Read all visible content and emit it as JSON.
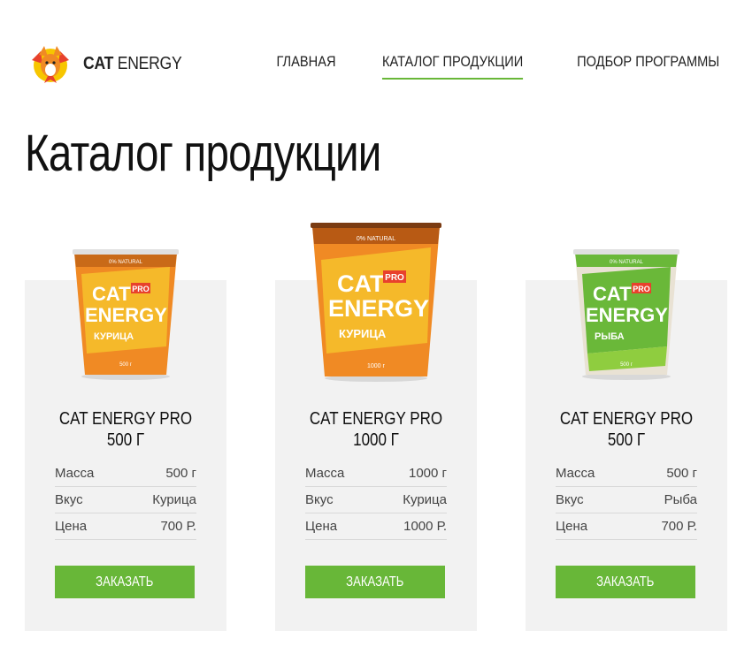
{
  "header": {
    "logo_bold": "CAT",
    "logo_light": "ENERGY",
    "nav": [
      {
        "label": "ГЛАВНАЯ",
        "active": false
      },
      {
        "label": "КАТАЛОГ ПРОДУКЦИИ",
        "active": true
      },
      {
        "label": "ПОДБОР ПРОГРАММЫ",
        "active": false
      }
    ]
  },
  "page_title": "Каталог продукции",
  "products": [
    {
      "title_line1": "CAT ENERGY PRO",
      "title_line2": "500 Г",
      "cup": {
        "brand1": "CAT",
        "brand2": "ENERGY",
        "pro": "PRO",
        "flavor": "КУРИЦА",
        "weight": "500 г",
        "top_text": "0% NATURAL",
        "color": "#f08a24",
        "band": "#f5b92a"
      },
      "specs": [
        {
          "label": "Масса",
          "value": "500 г"
        },
        {
          "label": "Вкус",
          "value": "Курица"
        },
        {
          "label": "Цена",
          "value": "700 Р."
        }
      ],
      "button": "ЗАКАЗАТЬ"
    },
    {
      "title_line1": "CAT ENERGY PRO",
      "title_line2": "1000 Г",
      "cup": {
        "brand1": "CAT",
        "brand2": "ENERGY",
        "pro": "PRO",
        "flavor": "КУРИЦА",
        "weight": "1000 г",
        "top_text": "0% NATURAL",
        "color": "#f08a24",
        "band": "#f5b92a"
      },
      "specs": [
        {
          "label": "Масса",
          "value": "1000 г"
        },
        {
          "label": "Вкус",
          "value": "Курица"
        },
        {
          "label": "Цена",
          "value": "1000 Р."
        }
      ],
      "button": "ЗАКАЗАТЬ"
    },
    {
      "title_line1": "CAT ENERGY PRO",
      "title_line2": "500 Г",
      "cup": {
        "brand1": "CAT",
        "brand2": "ENERGY",
        "pro": "PRO",
        "flavor": "РЫБА",
        "weight": "500 г",
        "top_text": "0% NATURAL",
        "color": "#6ab839",
        "band": "#8fcd3f"
      },
      "specs": [
        {
          "label": "Масса",
          "value": "500 г"
        },
        {
          "label": "Вкус",
          "value": "Рыба"
        },
        {
          "label": "Цена",
          "value": "700 Р."
        }
      ],
      "button": "ЗАКАЗАТЬ"
    }
  ],
  "colors": {
    "accent": "#68b738",
    "card_bg": "#f2f2f2"
  },
  "icons": {
    "logo": "cat-fox-logo-icon"
  }
}
